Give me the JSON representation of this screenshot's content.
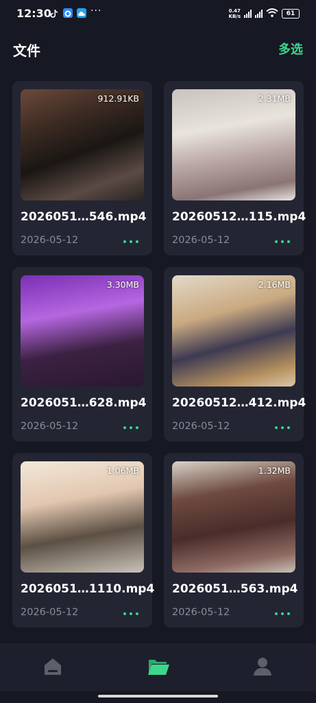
{
  "status_bar": {
    "time": "12:30",
    "dots": "···",
    "speed_value": "0.47",
    "speed_unit": "KB/s",
    "battery": "61"
  },
  "header": {
    "title": "文件",
    "action": "多选"
  },
  "files": [
    {
      "name": "2026051…546.mp4",
      "date": "2026-05-12",
      "size": "912.91KB"
    },
    {
      "name": "20260512…115.mp4",
      "date": "2026-05-12",
      "size": "2.31MB"
    },
    {
      "name": "2026051…628.mp4",
      "date": "2026-05-12",
      "size": "3.30MB"
    },
    {
      "name": "20260512…412.mp4",
      "date": "2026-05-12",
      "size": "2.16MB"
    },
    {
      "name": "2026051…1110.mp4",
      "date": "2026-05-12",
      "size": "1.06MB"
    },
    {
      "name": "2026051…563.mp4",
      "date": "2026-05-12",
      "size": "1.32MB"
    }
  ],
  "nav": {
    "items": [
      {
        "icon": "home-icon",
        "active": false
      },
      {
        "icon": "folder-icon",
        "active": true
      },
      {
        "icon": "person-icon",
        "active": false
      }
    ]
  },
  "colors": {
    "background": "#161823",
    "card": "#232533",
    "accent": "#3dd68c",
    "muted_text": "#8a8c97",
    "inactive_icon": "#5d5f6b"
  }
}
